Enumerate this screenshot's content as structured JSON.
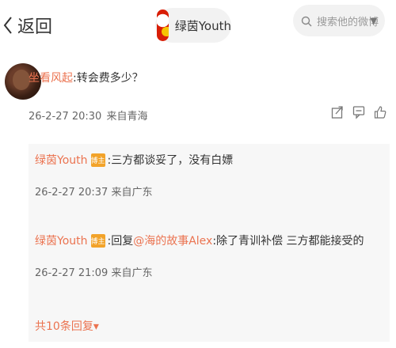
{
  "header": {
    "back_label": "返回",
    "user_name": "绿茵Youth",
    "search_placeholder": "搜索他的微博",
    "search_caret": "▼"
  },
  "comment": {
    "username": "坐看风起",
    "text": ":转会费多少？",
    "time": "26-2-27 20:30",
    "location": "来自青海"
  },
  "replies": [
    {
      "username": "绿茵Youth",
      "badge": "博主",
      "text": ":三方都谈妥了，没有白嫖",
      "time": "26-2-27 20:37",
      "location": "来自广东"
    },
    {
      "username": "绿茵Youth",
      "badge": "博主",
      "prefix": ":回复",
      "mention": "@海的故事Alex",
      "text": ":除了青训补偿 三方都能接受的",
      "time": "26-2-27 21:09",
      "location": "来自广东"
    }
  ],
  "more_replies": "共10条回复▾",
  "icons": {
    "back": "chevron-left-icon",
    "search": "search-icon",
    "share": "share-icon",
    "comment": "comment-icon",
    "like": "like-icon"
  },
  "colors": {
    "accent": "#eb7350",
    "badge": "#f2a32a",
    "reply_bg": "#f7f7f7"
  }
}
